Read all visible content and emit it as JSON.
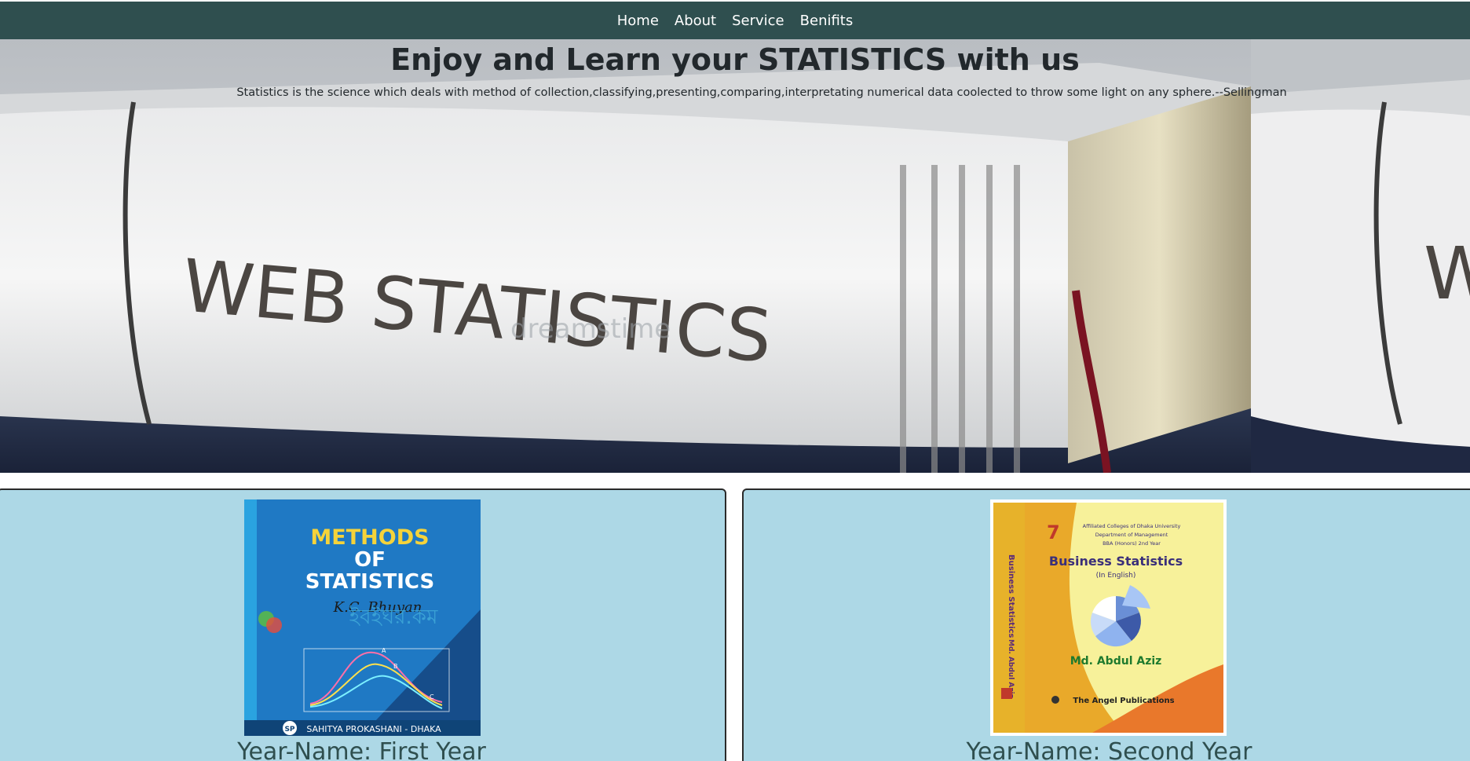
{
  "nav": {
    "items": [
      {
        "label": "Home"
      },
      {
        "label": "About"
      },
      {
        "label": "Service"
      },
      {
        "label": "Benifits"
      }
    ]
  },
  "hero": {
    "title": "Enjoy and Learn your STATISTICS with us",
    "quote": "Statistics is the science which deals with method of collection,classifying,presenting,comparing,interpretating numerical data coolected to throw some light on any sphere.--Sellingman",
    "book_spine_text": "WEB STATISTICS",
    "watermark": "dreamstime"
  },
  "cards": [
    {
      "label": "Year-Name: First Year",
      "cover": {
        "title_line1": "METHODS",
        "title_line2": "OF",
        "title_line3": "STATISTICS",
        "author": "K.C. Bhuyan",
        "publisher": "SAHITYA PROKASHANI - DHAKA",
        "publisher_mark": "SP",
        "watermark": "ইবইঘর.কম",
        "curve_labels": [
          "A",
          "B",
          "C"
        ],
        "bg_color": "#1f79c4"
      }
    },
    {
      "label": "Year-Name: Second Year",
      "cover": {
        "edition": "7",
        "header_line1": "Affiliated Colleges of Dhaka University",
        "header_line2": "Department of Management",
        "header_line3": "BBA (Honors) 2nd Year",
        "title": "Business Statistics",
        "subtitle": "(In English)",
        "author": "Md. Abdul Aziz",
        "publisher": "The Angel Publications",
        "spine_title": "Business Statistics",
        "spine_author": "Md. Abdul Aziz"
      }
    }
  ],
  "colors": {
    "nav_bg": "#2f4f4f",
    "card_bg": "#add8e6",
    "label_color": "#2f4f4f"
  }
}
